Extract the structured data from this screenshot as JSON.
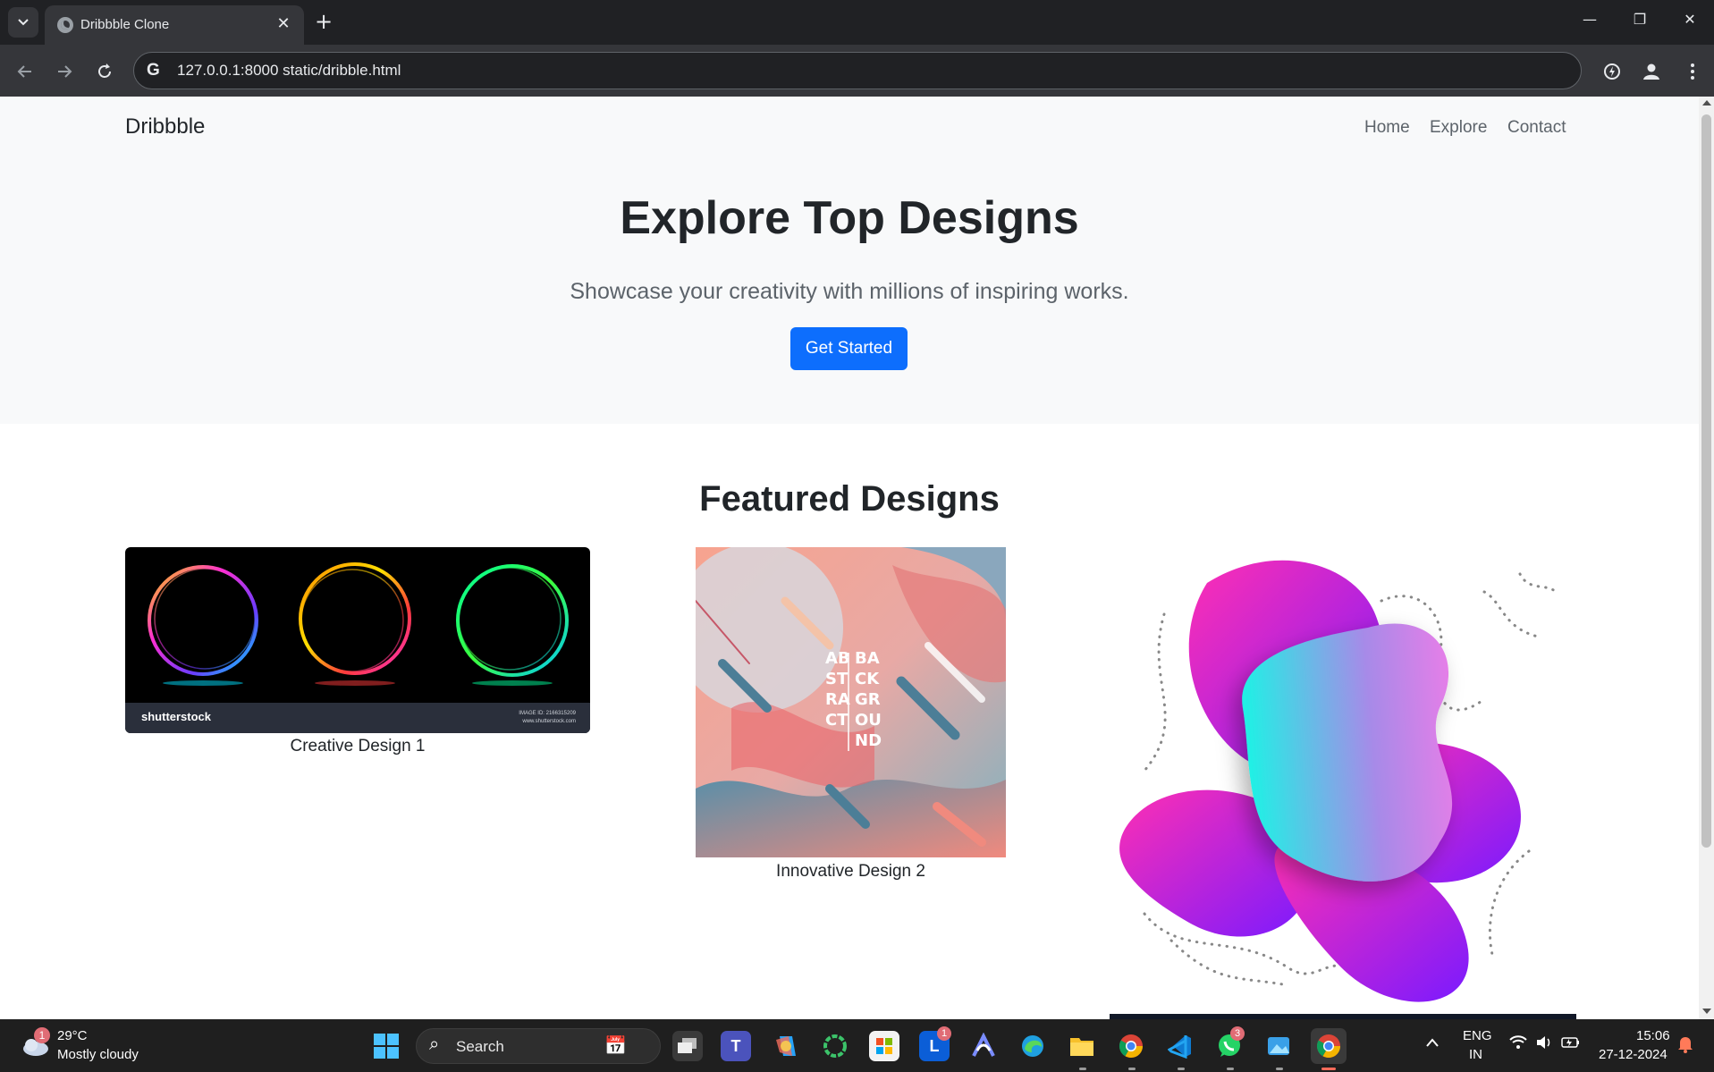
{
  "browser": {
    "tab_title": "Dribbble Clone",
    "new_tab": "+",
    "tab_close": "✕",
    "url": "127.0.0.1:8000 static/dribble.html",
    "window_controls": {
      "minimize": "—",
      "restore": "❐",
      "close": "✕"
    },
    "icons": [
      "tab-search-icon",
      "globe-favicon-icon",
      "back-icon",
      "forward-icon",
      "reload-icon",
      "google-icon",
      "performance-icon",
      "profile-icon",
      "menu-icon"
    ]
  },
  "site": {
    "brand": "Dribbble",
    "nav": [
      "Home",
      "Explore",
      "Contact"
    ],
    "hero": {
      "title": "Explore Top Designs",
      "subtitle": "Showcase your creativity with millions of inspiring works.",
      "cta": "Get Started"
    },
    "featured": {
      "title": "Featured Designs",
      "cards": [
        {
          "caption": "Creative Design 1",
          "watermark": "shutterstock",
          "image_id": "IMAGE ID: 2166315209",
          "site": "www.shutterstock.com"
        },
        {
          "caption": "Innovative Design 2",
          "text_lines": [
            "AB",
            "BA",
            "ST",
            "CK",
            "RA",
            "GR",
            "CT",
            "OU",
            "",
            "ND"
          ]
        },
        {
          "caption": ""
        }
      ]
    },
    "colors": {
      "primary": "#0d6efd",
      "nav_bg": "#f8f9fa",
      "text": "#212529",
      "muted": "#5c636a"
    }
  },
  "taskbar": {
    "weather": {
      "temp": "29°C",
      "desc": "Mostly cloudy",
      "badge": "1"
    },
    "search_label": "Search",
    "apps": [
      {
        "name": "task-view",
        "badge": ""
      },
      {
        "name": "teams",
        "badge": ""
      },
      {
        "name": "copilot",
        "badge": ""
      },
      {
        "name": "circle-app",
        "badge": ""
      },
      {
        "name": "microsoft-store",
        "badge": ""
      },
      {
        "name": "l-app",
        "badge": "1"
      },
      {
        "name": "arc-app",
        "badge": ""
      },
      {
        "name": "edge",
        "badge": ""
      },
      {
        "name": "file-explorer",
        "badge": ""
      },
      {
        "name": "chrome",
        "badge": ""
      },
      {
        "name": "vscode",
        "badge": ""
      },
      {
        "name": "whatsapp",
        "badge": "3"
      },
      {
        "name": "photos",
        "badge": ""
      },
      {
        "name": "chrome-active",
        "badge": ""
      }
    ],
    "tray": {
      "lang1": "ENG",
      "lang2": "IN",
      "time": "15:06",
      "date": "27-12-2024"
    }
  }
}
